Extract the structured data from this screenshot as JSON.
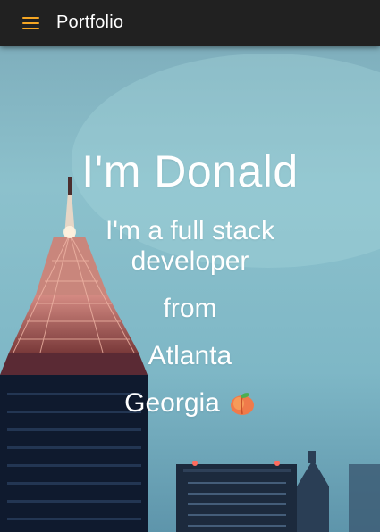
{
  "appbar": {
    "menu_icon": "hamburger-menu-icon",
    "title": "Portfolio",
    "accent_color": "#f5a623"
  },
  "hero": {
    "name": "I'm Donald",
    "role": "I'm a full stack developer",
    "from": "from",
    "city": "Atlanta",
    "state": "Georgia",
    "state_icon": "peach-emoji"
  }
}
